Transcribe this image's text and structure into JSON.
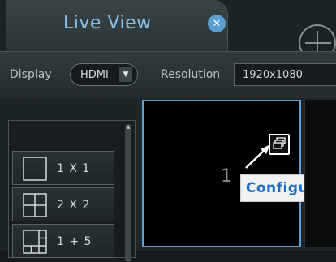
{
  "tab": {
    "title": "Live View",
    "close_glyph": "✕"
  },
  "settings": {
    "display_label": "Display",
    "display_value": "HDMI",
    "resolution_label": "Resolution",
    "resolution_value": "1920x1080"
  },
  "layouts": [
    {
      "label": "1 X 1",
      "icon": "layout-1x1-icon"
    },
    {
      "label": "2 X 2",
      "icon": "layout-2x2-icon"
    },
    {
      "label": "1 + 5",
      "icon": "layout-1plus5-icon"
    }
  ],
  "grid": {
    "selected_cell_number": "1"
  },
  "callout": {
    "configure_label": "Configure"
  },
  "colors": {
    "accent": "#5e9fd5",
    "callout_text": "#1e6fc4",
    "tab_title": "#86c2e9"
  }
}
